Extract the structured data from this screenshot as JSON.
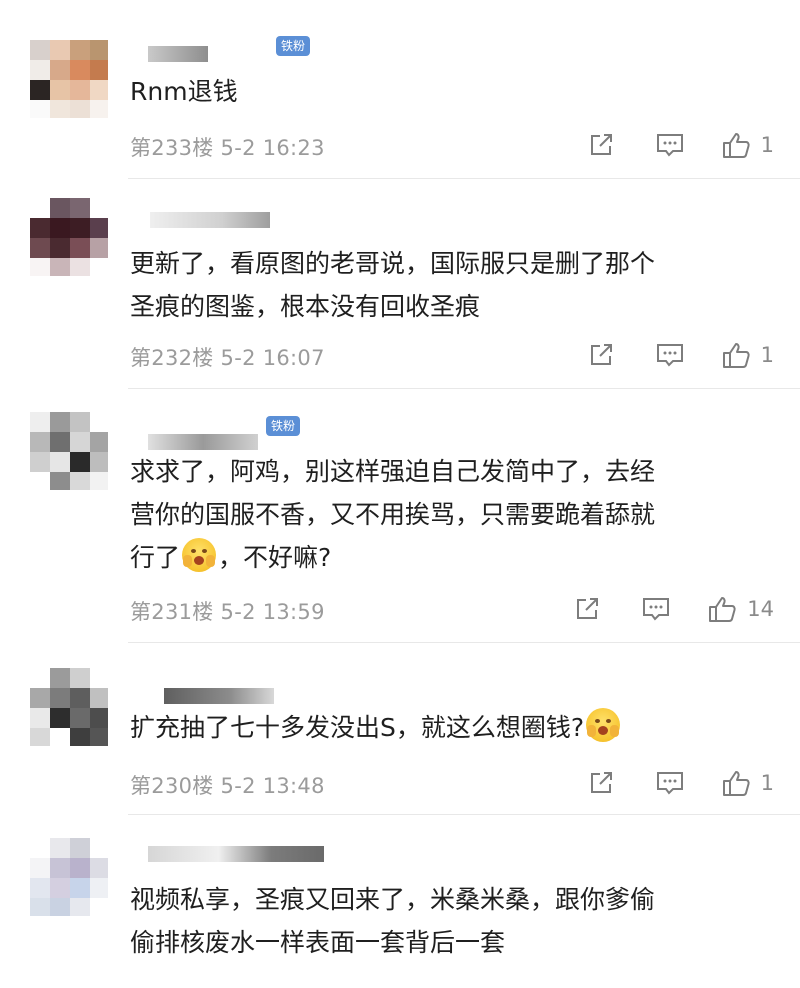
{
  "comments": [
    {
      "badge": "铁粉",
      "text": "Rnm退钱",
      "meta": "第233楼 5-2 16:23",
      "likes": "1",
      "emoji_after": false
    },
    {
      "badge": "",
      "text": "更新了，看原图的老哥说，国际服只是删了那个\n圣痕的图鉴，根本没有回收圣痕",
      "meta": "第232楼 5-2 16:07",
      "likes": "1",
      "emoji_after": false
    },
    {
      "badge": "铁粉",
      "text_before_emoji": "求求了，阿鸡，别这样强迫自己发简中了，去经\n营你的国服不香，又不用挨骂，只需要跪着舔就\n行了",
      "text_after_emoji": "，不好嘛?",
      "meta": "第231楼 5-2 13:59",
      "likes": "14",
      "emoji": "hug-emoji"
    },
    {
      "badge": "",
      "text_before_emoji": "扩充抽了七十多发没出S，就这么想圈钱?",
      "text_after_emoji": "",
      "meta": "第230楼 5-2 13:48",
      "likes": "1",
      "emoji": "hug-emoji"
    },
    {
      "badge": "",
      "text": "视频私享，圣痕又回来了，米桑米桑，跟你爹偷\n偷排核废水一样表面一套背后一套",
      "meta": "",
      "likes": "",
      "emoji_after": false
    }
  ],
  "icons": {
    "share": "share-icon",
    "reply": "comment-icon",
    "like": "thumbs-up-icon"
  },
  "colors": {
    "badge_bg": "#5b8fd6",
    "meta_text": "#9b9b9b",
    "divider": "#e8e8e8"
  }
}
